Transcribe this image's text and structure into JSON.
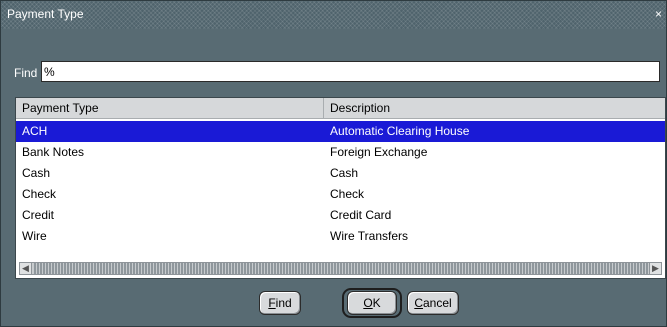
{
  "window": {
    "title": "Payment Type",
    "close_glyph": "×"
  },
  "find": {
    "label": "Find",
    "value": "%"
  },
  "table": {
    "columns": [
      "Payment Type",
      "Description"
    ],
    "rows": [
      {
        "type": "ACH",
        "description": "Automatic Clearing House",
        "selected": true
      },
      {
        "type": "Bank Notes",
        "description": "Foreign Exchange",
        "selected": false
      },
      {
        "type": "Cash",
        "description": "Cash",
        "selected": false
      },
      {
        "type": "Check",
        "description": "Check",
        "selected": false
      },
      {
        "type": "Credit",
        "description": "Credit Card",
        "selected": false
      },
      {
        "type": "Wire",
        "description": "Wire Transfers",
        "selected": false
      }
    ]
  },
  "buttons": {
    "find": {
      "mnemonic": "F",
      "rest": "ind"
    },
    "ok": {
      "mnemonic": "O",
      "rest": "K"
    },
    "cancel": {
      "mnemonic": "C",
      "rest": "ancel"
    }
  },
  "colors": {
    "selection": "#1a1ad6",
    "window_bg": "#586b73"
  }
}
